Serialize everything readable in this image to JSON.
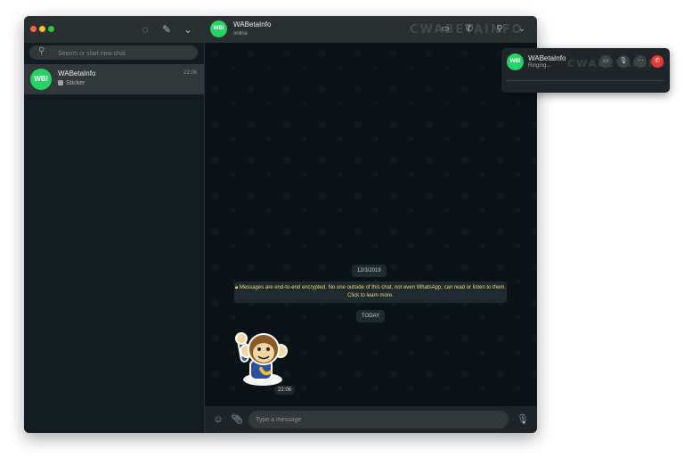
{
  "app": {
    "contact_name": "WABetaInfo",
    "avatar_text": "WBI",
    "brand_color": "#25d366",
    "watermark": "CWABETAINFO"
  },
  "sidebar": {
    "search_placeholder": "Search or start new chat",
    "icons": [
      "status-icon",
      "new-chat-icon",
      "chevron-down-icon"
    ],
    "chats": [
      {
        "name": "WABetaInfo",
        "time": "22:06",
        "preview": "Sticker"
      }
    ]
  },
  "chat": {
    "header_name": "WABetaInfo",
    "header_status": "online",
    "date_label": "12/3/2019",
    "encryption_notice": "Messages are end-to-end encrypted. No one outside of this chat, not even WhatsApp, can read or listen to them. Click to learn more.",
    "today_label": "TODAY",
    "sticker_time": "22:06",
    "message_placeholder": "Type a message"
  },
  "call": {
    "name": "WABetaInfo",
    "status": "Ringing...",
    "end_color": "#e53935"
  }
}
